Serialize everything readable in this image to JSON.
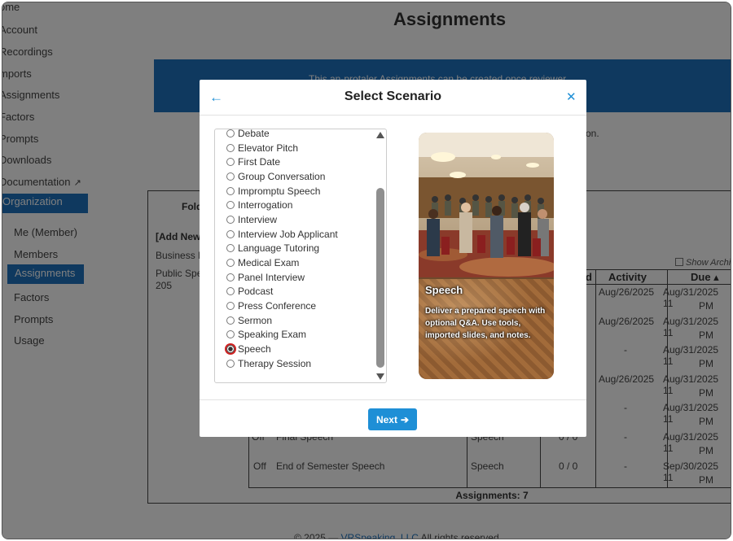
{
  "page": {
    "title": "Assignments",
    "banner_text": "This an-protaler Assignments can be created once reviewer",
    "bg_line": "on."
  },
  "sidebar": {
    "items": [
      {
        "label": "ome"
      },
      {
        "label": "Account"
      },
      {
        "label": "Recordings"
      },
      {
        "label": "mports"
      },
      {
        "label": "Assignments"
      },
      {
        "label": "Factors"
      },
      {
        "label": "Prompts"
      },
      {
        "label": "Downloads"
      },
      {
        "label": "Documentation"
      },
      {
        "label": "Organization"
      }
    ],
    "sub_items": [
      {
        "label": "Me (Member)"
      },
      {
        "label": "Members"
      },
      {
        "label": "Assignments"
      },
      {
        "label": "Factors"
      },
      {
        "label": "Prompts"
      },
      {
        "label": "Usage"
      }
    ]
  },
  "table": {
    "folder_header": "Fold",
    "add_new": "[Add New",
    "folder_item_1": "Business E",
    "folder_item_2": "Public Spe",
    "folder_item_3": "205",
    "show_archived": "Show Archi",
    "columns": {
      "c3": "d",
      "activity": "Activity",
      "due": "Due ▴"
    },
    "rows": [
      {
        "activity": "Aug/26/2025",
        "due1": "Aug/31/2025 11",
        "due2": "PM"
      },
      {
        "activity": "Aug/26/2025",
        "due1": "Aug/31/2025 11",
        "due2": "PM"
      },
      {
        "activity": "-",
        "due1": "Aug/31/2025 11",
        "due2": "PM"
      },
      {
        "activity": "Aug/26/2025",
        "due1": "Aug/31/2025 11",
        "due2": "PM"
      },
      {
        "activity": "-",
        "due1": "Aug/31/2025 11",
        "due2": "PM"
      },
      {
        "activity": "-",
        "due1": "Aug/31/2025 11",
        "due2": "PM"
      },
      {
        "off": "Off",
        "name": "End of Semester Speech",
        "type": "Speech",
        "count": "0 / 0",
        "activity": "-",
        "due1": "Sep/30/2025 11",
        "due2": "PM"
      }
    ],
    "partial_row": {
      "off": "Off",
      "name": "Final Speech",
      "type": "Speech",
      "count": "0 / 0"
    },
    "summary": "Assignments: 7"
  },
  "footer": {
    "copyright_prefix": "© 2025 — ",
    "company": "VRSpeaking, LLC",
    "copyright_suffix": " All rights reserved."
  },
  "modal": {
    "title": "Select Scenario",
    "back_icon": "arrow-left-icon",
    "close_icon": "close-icon",
    "options": [
      {
        "label": "Debate"
      },
      {
        "label": "Elevator Pitch"
      },
      {
        "label": "First Date"
      },
      {
        "label": "Group Conversation"
      },
      {
        "label": "Impromptu Speech"
      },
      {
        "label": "Interrogation"
      },
      {
        "label": "Interview"
      },
      {
        "label": "Interview Job Applicant"
      },
      {
        "label": "Language Tutoring"
      },
      {
        "label": "Medical Exam"
      },
      {
        "label": "Panel Interview"
      },
      {
        "label": "Podcast"
      },
      {
        "label": "Press Conference"
      },
      {
        "label": "Sermon"
      },
      {
        "label": "Speaking Exam"
      },
      {
        "label": "Speech"
      },
      {
        "label": "Therapy Session"
      }
    ],
    "selected": "Speech",
    "preview": {
      "title": "Speech",
      "description": "Deliver a prepared speech with optional Q&A. Use tools, imported slides, and notes."
    },
    "next_label": "Next",
    "accent": "#1e8fd6"
  }
}
